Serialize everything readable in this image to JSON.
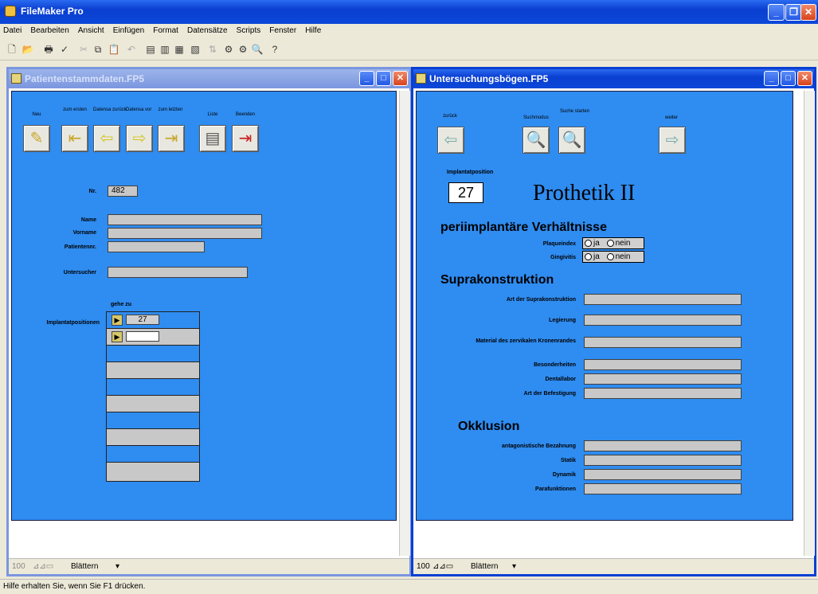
{
  "app": {
    "title": "FileMaker Pro"
  },
  "menu": [
    "Datei",
    "Bearbeiten",
    "Ansicht",
    "Einfügen",
    "Format",
    "Datensätze",
    "Scripts",
    "Fenster",
    "Hilfe"
  ],
  "toolbar_icons": [
    "new-icon",
    "open-icon",
    "print-icon",
    "spell-check-icon",
    "cut-icon",
    "copy-icon",
    "paste-icon",
    "undo-icon",
    "browse-icon",
    "find-icon",
    "layout-icon",
    "preview-icon",
    "sort-icon",
    "omit-icon",
    "show-all-icon",
    "help-icon"
  ],
  "left_window": {
    "title": "Patientenstammdaten.FP5",
    "nav_buttons": [
      {
        "label": "Neu",
        "icon": "new-record-icon"
      },
      {
        "label": "zum ersten",
        "icon": "first-record-icon"
      },
      {
        "label": "Datensa zurück",
        "icon": "previous-record-icon"
      },
      {
        "label": "Datensa vor",
        "icon": "next-record-icon"
      },
      {
        "label": "zum letzten",
        "icon": "last-record-icon"
      },
      {
        "label": "Liste",
        "icon": "list-icon"
      },
      {
        "label": "Beenden",
        "icon": "exit-icon"
      }
    ],
    "nr_label": "Nr.",
    "nr_value": "482",
    "name_label": "Name",
    "vorname_label": "Vorname",
    "patientennr_label": "Patientennr.",
    "untersucher_label": "Untersucher",
    "gehe_zu_label": "gehe zu",
    "implantat_label": "Implantatpositionen",
    "portal_first_value": "27",
    "status_zoom": "100",
    "status_mode": "Blättern"
  },
  "right_window": {
    "title": "Untersuchungsbögen.FP5",
    "nav_buttons": [
      {
        "label": "zurück",
        "icon": "back-arrow-icon"
      },
      {
        "label": "Suchmodus",
        "icon": "search-mode-icon"
      },
      {
        "label": "Suche starten",
        "icon": "search-start-icon"
      },
      {
        "label": "weiter",
        "icon": "forward-arrow-icon"
      }
    ],
    "implantatposition_label": "Implantatposition",
    "implantatposition_value": "27",
    "heading": "Prothetik II",
    "section1": "periimplantäre Verhältnisse",
    "plaqueindex_label": "Plaqueindex",
    "gingivitis_label": "Gingivitis",
    "ja": "ja",
    "nein": "nein",
    "section2": "Suprakonstruktion",
    "supra_fields": [
      "Art der Suprakonstruktion",
      "Legierung",
      "Material des zervikalen Kronenrandes",
      "Besonderheiten",
      "Dentallabor",
      "Art der Befestigung"
    ],
    "section3": "Okklusion",
    "okklusion_fields": [
      "antagonistische Bezahnung",
      "Statik",
      "Dynamik",
      "Parafunktionen"
    ],
    "status_zoom": "100",
    "status_mode": "Blättern"
  },
  "statusbar": {
    "text": "Hilfe erhalten Sie, wenn Sie F1 drücken."
  }
}
